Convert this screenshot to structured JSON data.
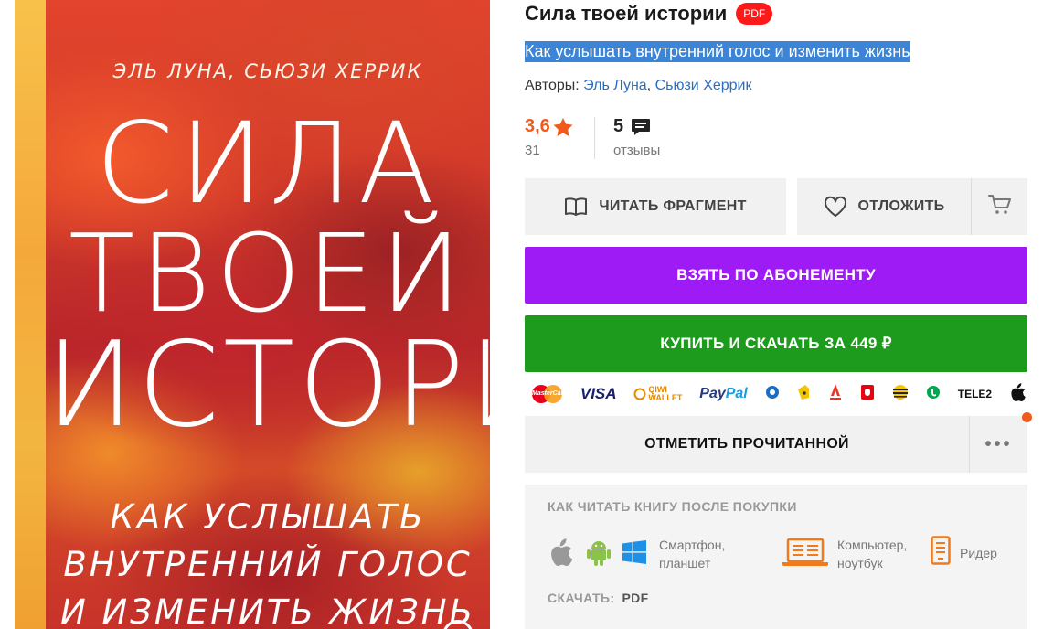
{
  "cover": {
    "authors": "ЭЛЬ ЛУНА, СЬЮЗИ ХЕРРИК",
    "title_lines": [
      "СИЛА",
      "ТВОЕЙ",
      "ИСТОРИИ"
    ],
    "subtitle_lines": [
      "КАК УСЛЫШАТЬ",
      "ВНУТРЕННИЙ ГОЛОС",
      "И ИЗМЕНИТЬ ЖИЗНЬ"
    ]
  },
  "book": {
    "title": "Сила твоей истории",
    "format_badge": "PDF",
    "subtitle": "Как услышать внутренний голос и изменить жизнь",
    "authors_label": "Авторы:",
    "authors": [
      "Эль Луна",
      "Сьюзи Херрик"
    ],
    "authors_separator": ","
  },
  "rating": {
    "value": "3,6",
    "count": "31",
    "icon": "star-icon"
  },
  "reviews": {
    "value": "5",
    "label": "отзывы",
    "icon": "comment-icon"
  },
  "actions": {
    "read_fragment": "ЧИТАТЬ ФРАГМЕНТ",
    "postpone": "ОТЛОЖИТЬ",
    "subscribe": "ВЗЯТЬ ПО АБОНЕМЕНТУ",
    "buy": "КУПИТЬ И СКАЧАТЬ ЗА 449 ₽",
    "mark_read": "ОТМЕТИТЬ ПРОЧИТАННОЙ",
    "more": "•••"
  },
  "payments": {
    "mastercard": "MasterCard",
    "visa": "VISA",
    "qiwi_line1": "QIWI",
    "qiwi_line2": "WALLET",
    "paypal_a": "Pay",
    "paypal_b": "Pal",
    "tele2": "TELE2"
  },
  "how_to_read": {
    "title": "КАК ЧИТАТЬ КНИГУ ПОСЛЕ ПОКУПКИ",
    "mobile_label_1": "Смартфон,",
    "mobile_label_2": "планшет",
    "desktop_label_1": "Компьютер,",
    "desktop_label_2": "ноутбук",
    "reader_label": "Ридер",
    "download_label": "СКАЧАТЬ:",
    "download_format": "PDF"
  },
  "colors": {
    "subscribe": "#9f1bf5",
    "buy": "#1c9b1c",
    "rating": "#f05a1c",
    "badge": "#ff1a1a",
    "link": "#2a6fbf"
  }
}
